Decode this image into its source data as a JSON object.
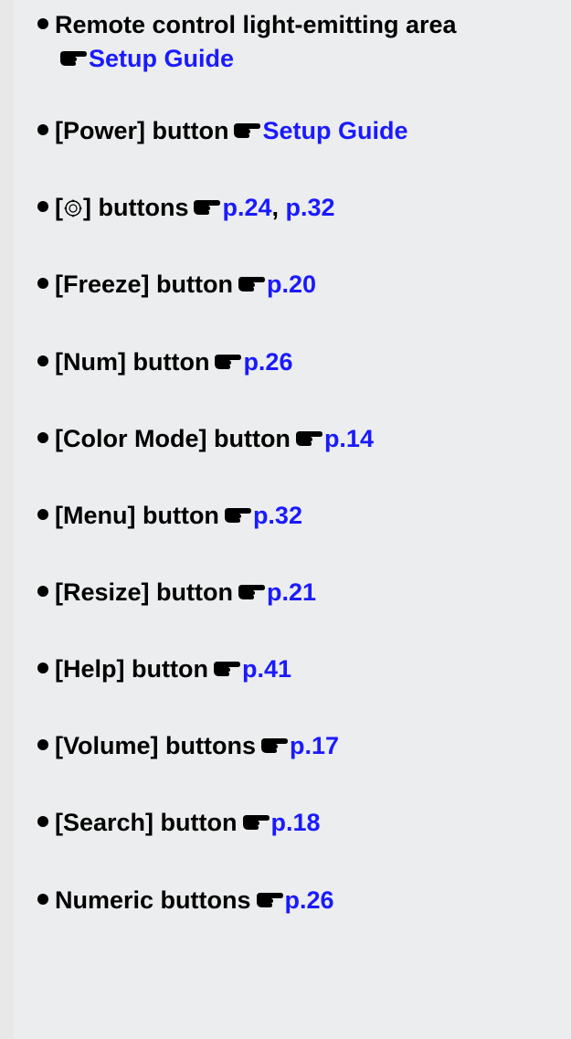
{
  "items": [
    {
      "label": "Remote control light-emitting area",
      "ref": "Setup Guide",
      "wrap": true
    },
    {
      "label": "[Power] button",
      "ref": "Setup Guide"
    },
    {
      "label_prefix": "[",
      "symbol": "directional-pad-icon",
      "label_suffix": "] buttons",
      "refs": [
        "p.24",
        "p.32"
      ]
    },
    {
      "label": "[Freeze] button",
      "ref": "p.20"
    },
    {
      "label": "[Num] button",
      "ref": "p.26"
    },
    {
      "label": "[Color Mode] button",
      "ref": "p.14"
    },
    {
      "label": "[Menu] button",
      "ref": "p.32"
    },
    {
      "label": "[Resize] button",
      "ref": "p.21"
    },
    {
      "label": "[Help] button",
      "ref": "p.41"
    },
    {
      "label": "[Volume] buttons",
      "ref": "p.17"
    },
    {
      "label": "[Search] button",
      "ref": "p.18"
    },
    {
      "label": "Numeric buttons",
      "ref": "p.26"
    }
  ],
  "colors": {
    "link": "#1a1aff",
    "text": "#000000",
    "background": "#ecedee"
  },
  "icons": {
    "reference": "pointing-hand-icon",
    "bullet": "bullet-dot-icon"
  }
}
